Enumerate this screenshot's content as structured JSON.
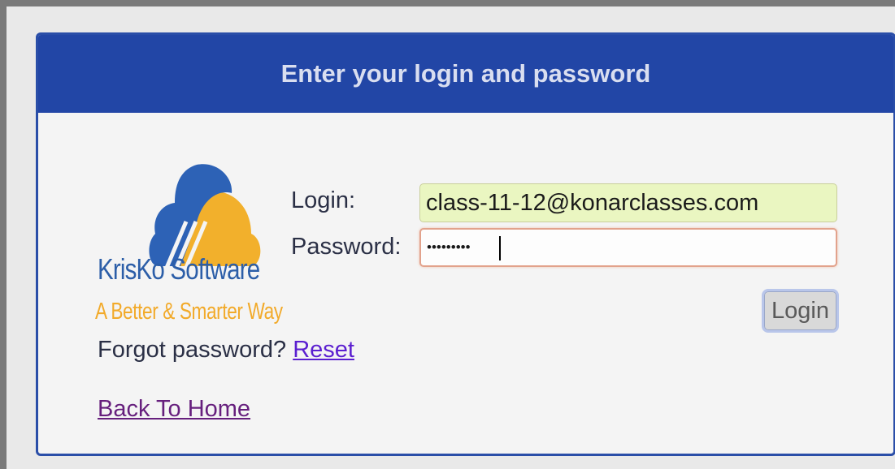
{
  "dialog": {
    "title": "Enter your login and password"
  },
  "logo": {
    "name": "KrisKo Software",
    "tagline": "A Better & Smarter Way"
  },
  "form": {
    "login_label": "Login:",
    "login_value": "class-11-12@konarclasses.com",
    "password_label": "Password:",
    "password_value": "•••••••••",
    "submit_label": "Login"
  },
  "links": {
    "forgot_text": "Forgot password?",
    "reset_label": "Reset",
    "home_label": "Back To Home"
  },
  "colors": {
    "header_bg": "#2246a6",
    "logo_blue": "#2c5ea8",
    "logo_orange": "#f2aa2a",
    "login_field_bg": "#eaf6c1",
    "link_color": "#5b1fd0"
  }
}
